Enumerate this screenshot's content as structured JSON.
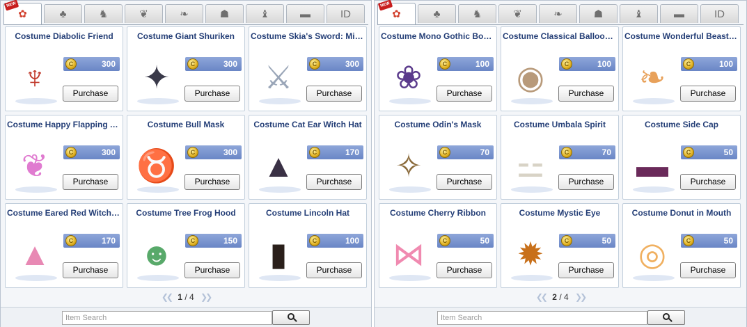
{
  "tab_icons": [
    "sparkle-icon",
    "cat-ears-icon",
    "horned-helm-icon",
    "leaf-icon",
    "wings-icon",
    "helmet-icon",
    "wolf-icon",
    "ticket-icon",
    "id-card-icon"
  ],
  "tab_glyphs": [
    "✿",
    "♣",
    "♞",
    "❦",
    "❧",
    "☗",
    "♝",
    "▬",
    "ID"
  ],
  "new_badge": "NEW",
  "coin_glyph": "C",
  "search_placeholder": "Item Search",
  "purchase_label": "Purchase",
  "panels": [
    {
      "page_current": "1",
      "page_sep": " / ",
      "page_total": "4",
      "items": [
        {
          "name": "Costume Diabolic Friend",
          "price": "300",
          "icon": "devil-wings-icon",
          "glyph": "♆",
          "color": "#c0392b"
        },
        {
          "name": "Costume Giant Shuriken",
          "price": "300",
          "icon": "shuriken-icon",
          "glyph": "✦",
          "color": "#3a3a4a"
        },
        {
          "name": "Costume Skia's Sword: Milky",
          "price": "300",
          "icon": "sword-icon",
          "glyph": "⚔",
          "color": "#9aa6b8"
        },
        {
          "name": "Costume Happy Flapping An...",
          "price": "300",
          "icon": "rainbow-wings-icon",
          "glyph": "❦",
          "color": "#e07bd0"
        },
        {
          "name": "Costume Bull Mask",
          "price": "300",
          "icon": "bull-mask-icon",
          "glyph": "♉",
          "color": "#5a5a5a"
        },
        {
          "name": "Costume Cat Ear Witch Hat",
          "price": "170",
          "icon": "witch-hat-icon",
          "glyph": "▲",
          "color": "#3a3145"
        },
        {
          "name": "Costume Eared Red Witch H...",
          "price": "170",
          "icon": "pink-witch-hat-icon",
          "glyph": "▲",
          "color": "#e889b4"
        },
        {
          "name": "Costume Tree Frog Hood",
          "price": "150",
          "icon": "frog-hood-icon",
          "glyph": "☻",
          "color": "#58a96a"
        },
        {
          "name": "Costume Lincoln Hat",
          "price": "100",
          "icon": "top-hat-icon",
          "glyph": "▮",
          "color": "#2a1f1a"
        }
      ]
    },
    {
      "page_current": "2",
      "page_sep": " / ",
      "page_total": "4",
      "items": [
        {
          "name": "Costume Mono Gothic Bonnet",
          "price": "100",
          "icon": "gothic-bonnet-icon",
          "glyph": "❀",
          "color": "#5b3b8c"
        },
        {
          "name": "Costume Classical Balloon ...",
          "price": "100",
          "icon": "balloon-hat-icon",
          "glyph": "◉",
          "color": "#b89a7a"
        },
        {
          "name": "Costume Wonderful Beast E...",
          "price": "100",
          "icon": "beast-ears-icon",
          "glyph": "❧",
          "color": "#e8a15a"
        },
        {
          "name": "Costume Odin's Mask",
          "price": "70",
          "icon": "odin-mask-icon",
          "glyph": "✧",
          "color": "#8a6a3a"
        },
        {
          "name": "Costume Umbala Spirit",
          "price": "70",
          "icon": "bone-icon",
          "glyph": "⚍",
          "color": "#d8d3c6"
        },
        {
          "name": "Costume Side Cap",
          "price": "50",
          "icon": "side-cap-icon",
          "glyph": "▬",
          "color": "#6a2a5a"
        },
        {
          "name": "Costume Cherry Ribbon",
          "price": "50",
          "icon": "ribbon-icon",
          "glyph": "⋈",
          "color": "#f08ab0"
        },
        {
          "name": "Costume Mystic Eye",
          "price": "50",
          "icon": "mystic-eye-icon",
          "glyph": "✹",
          "color": "#c8701a"
        },
        {
          "name": "Costume Donut in Mouth",
          "price": "50",
          "icon": "donut-icon",
          "glyph": "◎",
          "color": "#f0b060"
        }
      ]
    }
  ]
}
